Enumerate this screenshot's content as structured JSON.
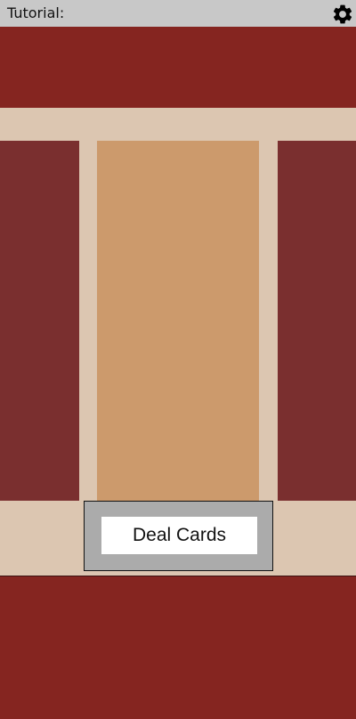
{
  "header": {
    "title": "Tutorial:",
    "settings_icon": "gear-icon"
  },
  "deal": {
    "button_label": "Deal Cards"
  },
  "colors": {
    "banner": "#852520",
    "felt": "#dcc6b1",
    "card_back": "#7a2f2f",
    "card_face": "#cc9a6c",
    "header_bg": "#c8c8c8",
    "panel_bg": "#ababab"
  }
}
